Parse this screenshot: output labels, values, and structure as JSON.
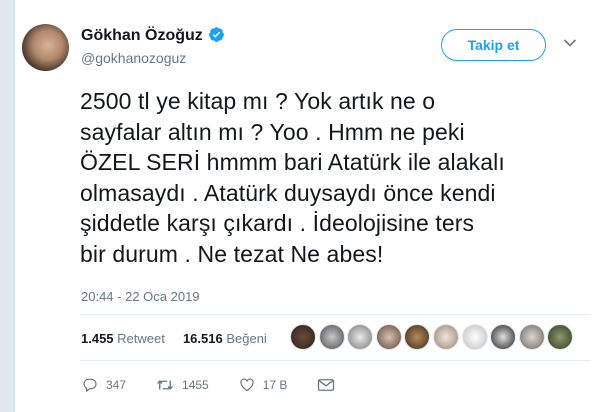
{
  "author": {
    "display_name": "Gökhan Özoğuz",
    "handle": "@gokhanozoguz"
  },
  "follow_button_label": "Takip et",
  "tweet": {
    "text": "2500 tl ye kitap mı ? Yok artık ne o\nsayfalar altın mı ? Yoo . Hmm ne peki\nÖZEL SERİ hmmm bari Atatürk ile alakalı\nolmasaydı . Atatürk duysaydı önce kendi\nşiddetle  karşı çıkardı . İdeolojisine ters\nbir durum . Ne tezat Ne abes!",
    "timestamp": "20:44 - 22 Oca 2019"
  },
  "stats": {
    "retweet_count": "1.455",
    "retweet_label": "Retweet",
    "like_count": "16.516",
    "like_label": "Beğeni"
  },
  "actions": {
    "reply_count": "347",
    "retweet_count": "1455",
    "like_count": "17 B"
  },
  "colors": {
    "accent": "#1da1f2",
    "secondary_text": "#657786"
  },
  "icons": [
    "verified-badge-icon",
    "chevron-down-icon",
    "reply-icon",
    "retweet-icon",
    "heart-icon",
    "envelope-icon"
  ]
}
